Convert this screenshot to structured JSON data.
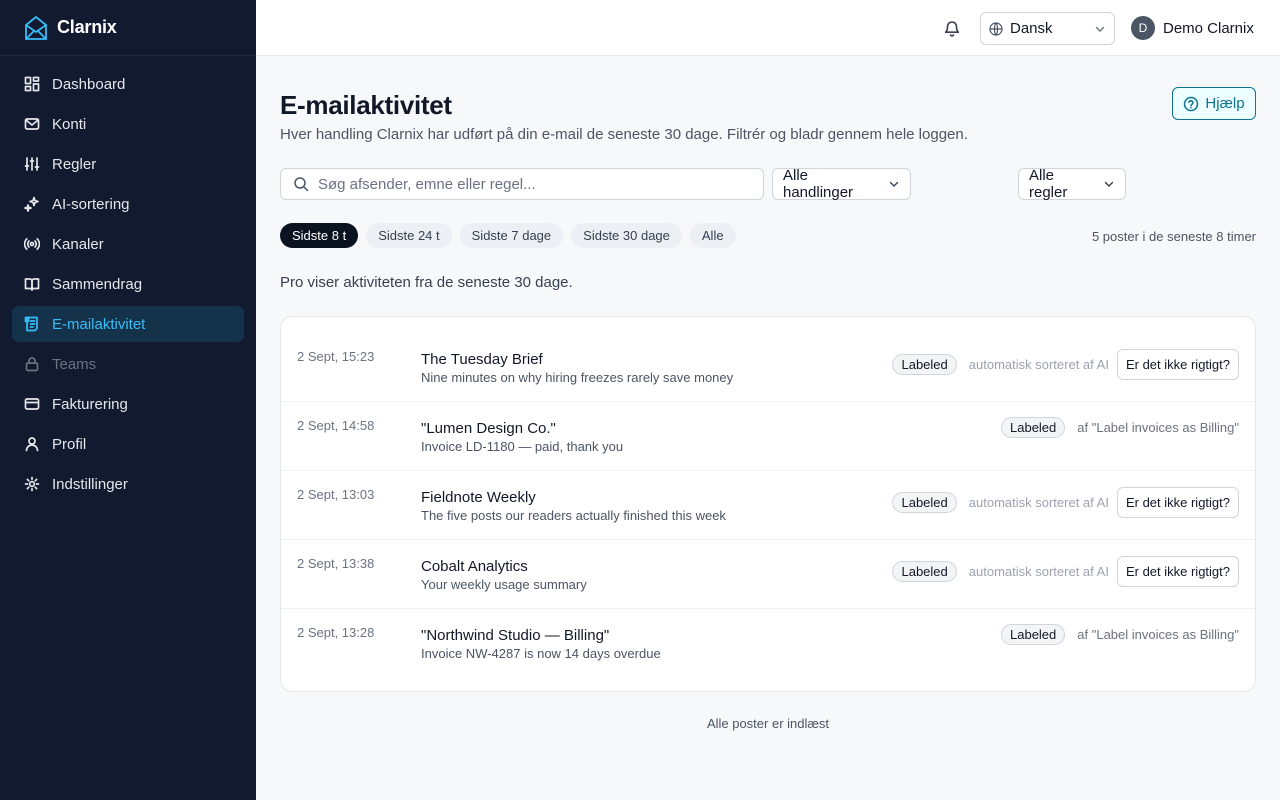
{
  "brand": {
    "name": "Clarnix"
  },
  "sidebar": {
    "items": [
      {
        "label": "Dashboard",
        "icon": "dashboard-icon"
      },
      {
        "label": "Konti",
        "icon": "mail-icon"
      },
      {
        "label": "Regler",
        "icon": "sliders-icon"
      },
      {
        "label": "AI-sortering",
        "icon": "sparkles-icon"
      },
      {
        "label": "Kanaler",
        "icon": "broadcast-icon"
      },
      {
        "label": "Sammendrag",
        "icon": "book-icon"
      },
      {
        "label": "E-mailaktivitet",
        "icon": "activity-log-icon",
        "active": true
      },
      {
        "label": "Teams",
        "icon": "lock-icon",
        "disabled": true
      },
      {
        "label": "Fakturering",
        "icon": "credit-card-icon"
      },
      {
        "label": "Profil",
        "icon": "user-icon"
      },
      {
        "label": "Indstillinger",
        "icon": "gear-icon"
      }
    ]
  },
  "header": {
    "language": "Dansk",
    "user": {
      "initial": "D",
      "name": "Demo Clarnix"
    }
  },
  "page": {
    "title": "E-mailaktivitet",
    "subtitle": "Hver handling Clarnix har udført på din e-mail de seneste 30 dage. Filtrér og bladr gennem hele loggen.",
    "help_label": "Hjælp"
  },
  "filters": {
    "search_placeholder": "Søg afsender, emne eller regel...",
    "actions_select": "Alle handlinger",
    "rules_select": "Alle regler",
    "chips": [
      "Sidste 8 t",
      "Sidste 24 t",
      "Sidste 7 dage",
      "Sidste 30 dage",
      "Alle"
    ],
    "active_chip": "Sidste 8 t",
    "count_text": "5 poster i de seneste 8 timer"
  },
  "pro_note": "Pro viser aktiviteten fra de seneste 30 dage.",
  "activity": {
    "rows": [
      {
        "time": "2 Sept, 15:23",
        "subject": "The Tuesday Brief",
        "snippet": "Nine minutes on why hiring freezes rarely save money",
        "badge": "Labeled",
        "source": "automatisk sorteret af AI",
        "action": "Er det ikke rigtigt?"
      },
      {
        "time": "2 Sept, 14:58",
        "subject": "\"Lumen Design Co.\"",
        "snippet": "Invoice LD-1180 — paid, thank you",
        "badge": "Labeled",
        "source": "af \"Label invoices as Billing\""
      },
      {
        "time": "2 Sept, 13:03",
        "subject": "Fieldnote Weekly",
        "snippet": "The five posts our readers actually finished this week",
        "badge": "Labeled",
        "source": "automatisk sorteret af AI",
        "action": "Er det ikke rigtigt?"
      },
      {
        "time": "2 Sept, 13:38",
        "subject": "Cobalt Analytics",
        "snippet": "Your weekly usage summary",
        "badge": "Labeled",
        "source": "automatisk sorteret af AI",
        "action": "Er det ikke rigtigt?"
      },
      {
        "time": "2 Sept, 13:28",
        "subject": "\"Northwind Studio — Billing\"",
        "snippet": "Invoice NW-4287 is now 14 days overdue",
        "badge": "Labeled",
        "source": "af \"Label invoices as Billing\""
      }
    ]
  },
  "footer_note": "Alle poster er indlæst",
  "colors": {
    "sidebar_bg": "#111a2e",
    "accent": "#38bdf8",
    "active_bg": "#14324a",
    "help_accent": "#0e7490"
  }
}
